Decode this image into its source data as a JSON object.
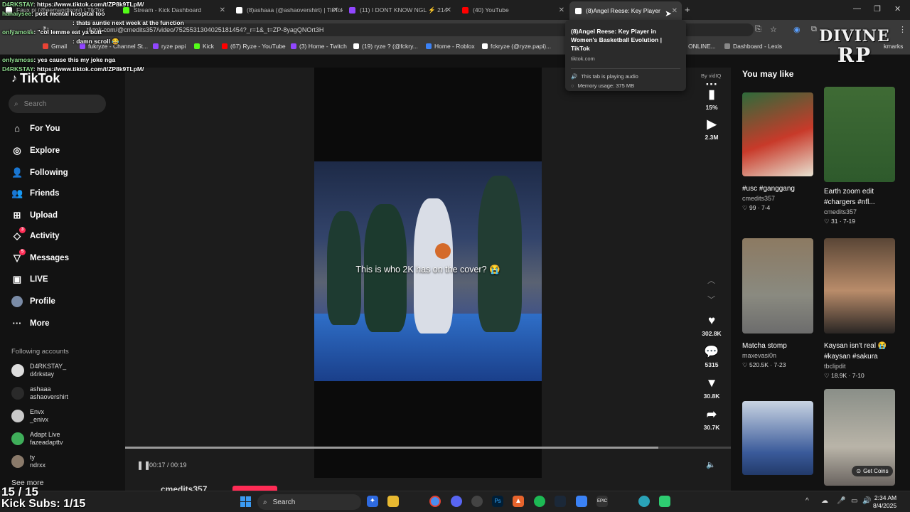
{
  "browser": {
    "tabs": [
      {
        "label": "Faux pi (@eemandisoni) | TikTok",
        "color": "#ffffff"
      },
      {
        "label": "Stream - Kick Dashboard",
        "color": "#53fc18"
      },
      {
        "label": "(8)ashaaa (@ashaovershirt) | TikTok",
        "color": "#ffffff"
      },
      {
        "label": "(11) I DONT KNOW NGL ⚡ 214",
        "color": "#9146ff"
      },
      {
        "label": "(40) YouTube",
        "color": "#ff0000"
      },
      {
        "label": "(8)Angel Reese: Key Player",
        "color": "#ffffff"
      }
    ],
    "url": "tiktok.com/@cmedits357/video/7525531304025181454?_r=1&_t=ZP-8yagQNOrt3H",
    "bookmarks": [
      {
        "label": "Gmail",
        "color": "#ea4335"
      },
      {
        "label": "fukryze - Channel St...",
        "color": "#9146ff"
      },
      {
        "label": "ryze papi",
        "color": "#9146ff"
      },
      {
        "label": "Kick",
        "color": "#53fc18"
      },
      {
        "label": "(67) Ryze - YouTube",
        "color": "#ff0000"
      },
      {
        "label": "(3) Home - Twitch",
        "color": "#9146ff"
      },
      {
        "label": "(19) ryze ? (@fckry...",
        "color": "#ffffff"
      },
      {
        "label": "Home - Roblox",
        "color": "#3b82f6"
      },
      {
        "label": "fckryze (@ryze.papi)...",
        "color": "#ffffff"
      },
      {
        "label": "ONLINE...",
        "color": "#888888"
      },
      {
        "label": "Dashboard - Lexis",
        "color": "#888888"
      },
      {
        "label": "kmarks",
        "color": "#888888"
      }
    ],
    "tooltip": {
      "title": "(8)Angel Reese: Key Player in Women's Basketball Evolution | TikTok",
      "host": "tiktok.com",
      "audio": "This tab is playing audio",
      "memory": "Memory usage: 375 MB"
    }
  },
  "tiktok": {
    "logo": "TikTok",
    "search_placeholder": "Search",
    "nav": [
      {
        "label": "For You",
        "icon": "home-icon"
      },
      {
        "label": "Explore",
        "icon": "compass-icon"
      },
      {
        "label": "Following",
        "icon": "following-icon"
      },
      {
        "label": "Friends",
        "icon": "friends-icon"
      },
      {
        "label": "Upload",
        "icon": "upload-icon"
      },
      {
        "label": "Activity",
        "icon": "activity-icon",
        "badge": "3"
      },
      {
        "label": "Messages",
        "icon": "messages-icon",
        "badge": "5"
      },
      {
        "label": "LIVE",
        "icon": "live-icon"
      },
      {
        "label": "Profile",
        "icon": "profile-icon"
      },
      {
        "label": "More",
        "icon": "more-icon"
      }
    ],
    "following_title": "Following accounts",
    "accounts": [
      {
        "name": "D4RKSTAY_",
        "handle": "d4rkstay"
      },
      {
        "name": "ashaaa",
        "handle": "ashaovershirt"
      },
      {
        "name": "Envx",
        "handle": "_enivx"
      },
      {
        "name": "Adapt Live",
        "handle": "fazeadapttv"
      },
      {
        "name": "ty",
        "handle": "ndrxx"
      }
    ],
    "see_more": "See more",
    "video": {
      "caption": "This is who 2K has on the cover? 😭",
      "time": "00:17 / 00:19",
      "progress": 0.88,
      "author_peek": "cmedits357"
    },
    "actions": {
      "by": "By vidIQ",
      "percent": "15%",
      "views": "2.3M",
      "likes": "302.8K",
      "comments": "5315",
      "saves": "30.8K",
      "shares": "30.7K"
    },
    "recommend_title": "You may like",
    "cards": [
      {
        "title": "#usc #ganggang",
        "author": "cmedits357",
        "stats": "♡ 99 · 7-4"
      },
      {
        "title": "Earth zoom edit #chargers #nfl...",
        "author": "cmedits357",
        "stats": "♡ 31 · 7-19"
      },
      {
        "title": "Matcha stomp",
        "author": "maxevasi0n",
        "stats": "♡ 520.5K · 7-23"
      },
      {
        "title": "Kaysan isn't real 😭 #kaysan #sakura",
        "author": "tbclipdit",
        "stats": "♡ 18.9K · 7-10"
      }
    ],
    "get_coins": "Get Coins"
  },
  "overlay": {
    "chat": [
      {
        "user": "D4RKSTAY",
        "text": ": https://www.tiktok.com/t/ZP8k9TLpM/"
      },
      {
        "user": "hanaiysee",
        "text": ": post mental hospital too"
      },
      {
        "user": "",
        "text": ": thats auntie next week at the function"
      },
      {
        "user": "onlyamoss",
        "text": ": \"col lemme eat ya butt\""
      },
      {
        "user": "",
        "text": ": damn scroll 😂"
      },
      {
        "user": "onlyamoss",
        "text": ": yes cause this my joke nga"
      },
      {
        "user": "D4RKSTAY",
        "text": ": https://www.tiktok.com/t/ZP8k9TLpM/"
      }
    ],
    "logo_line1": "DIVINE",
    "logo_line2": "RP",
    "count": "15 / 15",
    "subs": "Kick Subs: 1/15"
  },
  "taskbar": {
    "search": "Search",
    "time": "2:34 AM",
    "date": "8/4/2025"
  }
}
